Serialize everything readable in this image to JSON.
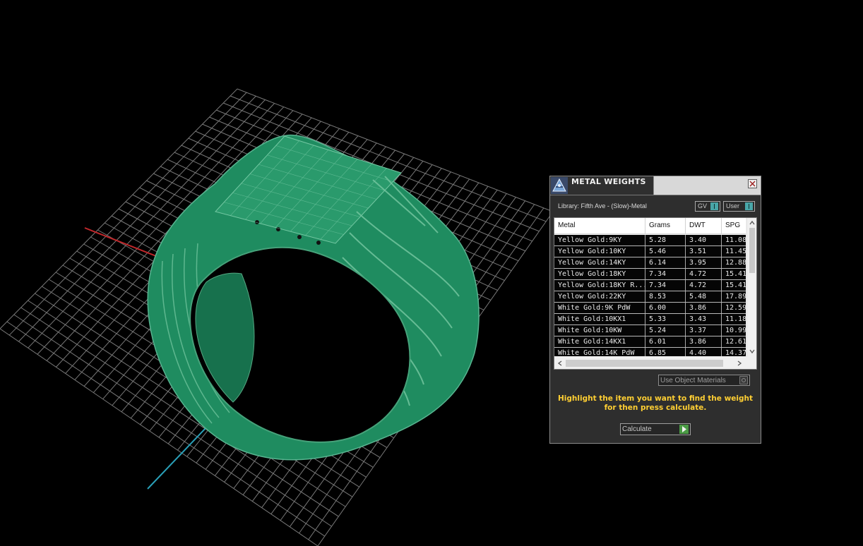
{
  "scene": {
    "grid_color": "#8e8e8e",
    "x_axis_color": "#c0282b",
    "y_axis_color": "#2aa0b8",
    "model_color": "#1f8c60",
    "model_wire_color": "#57b38f",
    "object": "signet-ring-wireframe"
  },
  "panel": {
    "title": "METAL WEIGHTS",
    "app_icon": "rhino-app-icon",
    "close_icon": "close-icon",
    "library_label": "Library: Fifth Ave - (Slow)-Metal",
    "toggles": [
      {
        "label": "GV"
      },
      {
        "label": "User"
      }
    ],
    "table": {
      "columns": [
        "Metal",
        "Grams",
        "DWT",
        "SPG"
      ],
      "rows": [
        {
          "metal": "Yellow Gold:9KY",
          "grams": "5.28",
          "dwt": "3.40",
          "spg": "11.08"
        },
        {
          "metal": "Yellow Gold:10KY",
          "grams": "5.46",
          "dwt": "3.51",
          "spg": "11.45"
        },
        {
          "metal": "Yellow Gold:14KY",
          "grams": "6.14",
          "dwt": "3.95",
          "spg": "12.88"
        },
        {
          "metal": "Yellow Gold:18KY",
          "grams": "7.34",
          "dwt": "4.72",
          "spg": "15.41"
        },
        {
          "metal": "Yellow Gold:18KY R...",
          "grams": "7.34",
          "dwt": "4.72",
          "spg": "15.41"
        },
        {
          "metal": "Yellow Gold:22KY",
          "grams": "8.53",
          "dwt": "5.48",
          "spg": "17.89"
        },
        {
          "metal": "White Gold:9K PdW",
          "grams": "6.00",
          "dwt": "3.86",
          "spg": "12.59"
        },
        {
          "metal": "White Gold:10KX1",
          "grams": "5.33",
          "dwt": "3.43",
          "spg": "11.18"
        },
        {
          "metal": "White Gold:10KW",
          "grams": "5.24",
          "dwt": "3.37",
          "spg": "10.99"
        },
        {
          "metal": "White Gold:14KX1",
          "grams": "6.01",
          "dwt": "3.86",
          "spg": "12.61"
        },
        {
          "metal": "White Gold:14K PdW",
          "grams": "6.85",
          "dwt": "4.40",
          "spg": "14.37"
        }
      ]
    },
    "use_object_materials_label": "Use Object Materials",
    "instructions": "Highlight the item you want to find the weight for then press calculate.",
    "calculate_label": "Calculate",
    "accent_yellow": "#ffcf33",
    "toggle_color": "#49a6a8",
    "play_color": "#4a9a44"
  }
}
